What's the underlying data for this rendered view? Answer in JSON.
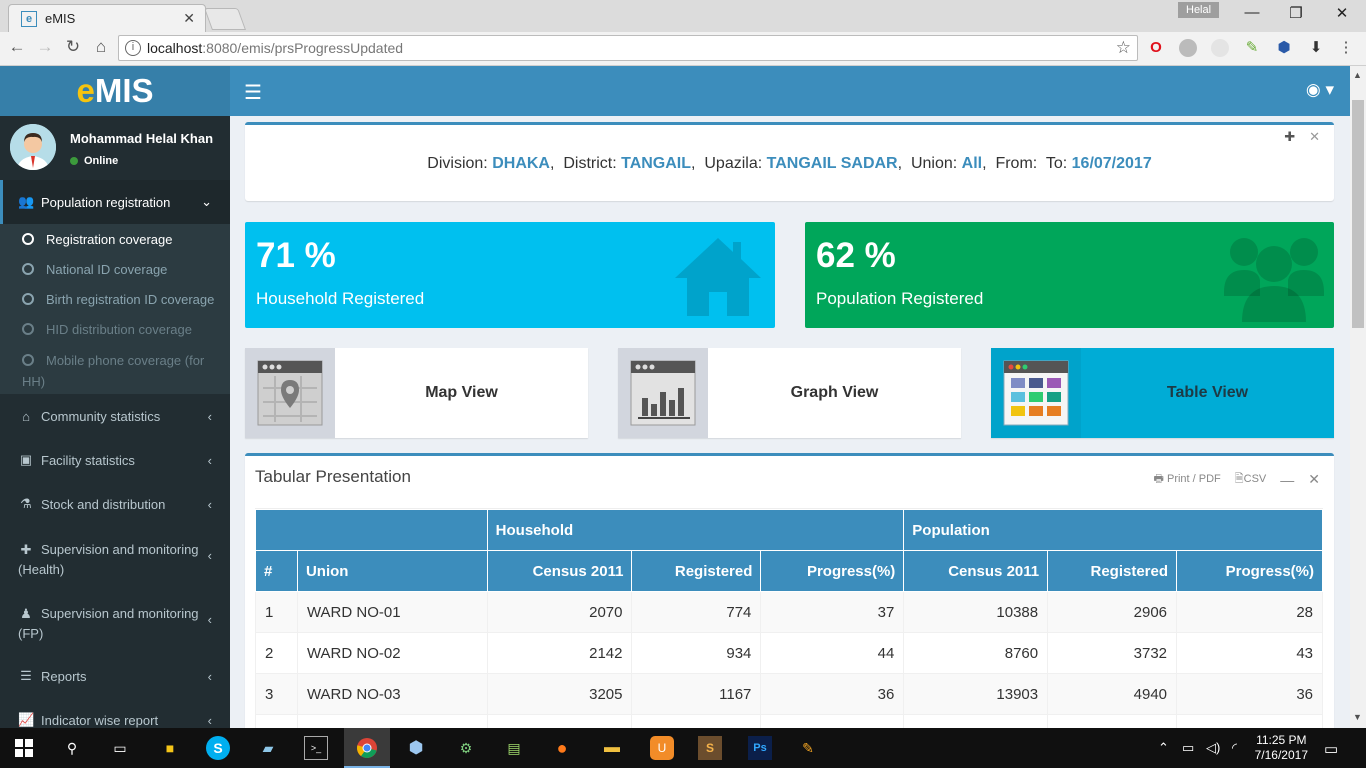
{
  "browser": {
    "tab_title": "eMIS",
    "tab_favicon": "e",
    "profile_name": "Helal",
    "url_host": "localhost",
    "url_rest": ":8080/emis/prsProgressUpdated"
  },
  "app": {
    "logo_e": "e",
    "logo_rest": "MIS",
    "user_name": "Mohammad Helal Khan",
    "user_status": "Online"
  },
  "sidebar": {
    "main_section": "Population registration",
    "sub_items": [
      "Registration coverage",
      "National ID coverage",
      "Birth registration ID coverage",
      "HID distribution coverage",
      "Mobile phone coverage (for",
      "HH)"
    ],
    "items": [
      "Community statistics",
      "Facility statistics",
      "Stock and distribution",
      "Supervision and monitoring",
      "(Health)",
      "Supervision and monitoring",
      "(FP)",
      "Reports",
      "Indicator wise report"
    ]
  },
  "filter": {
    "division_label": "Division:",
    "division": "DHAKA",
    "district_label": "District:",
    "district": "TANGAIL",
    "upazila_label": "Upazila:",
    "upazila": "TANGAIL SADAR",
    "union_label": "Union:",
    "union": "All",
    "from_label": "From:",
    "to_label": "To:",
    "to": "16/07/2017"
  },
  "stats": {
    "household_value": "71 %",
    "household_label": "Household Registered",
    "population_value": "62 %",
    "population_label": "Population Registered",
    "colors": {
      "household": "#00c0ef",
      "population": "#00a65a"
    }
  },
  "views": {
    "map": "Map View",
    "graph": "Graph View",
    "table": "Table View"
  },
  "table": {
    "title": "Tabular Presentation",
    "print": "Print / PDF",
    "csv": "CSV",
    "group_household": "Household",
    "group_population": "Population",
    "columns": [
      "#",
      "Union",
      "Census 2011",
      "Registered",
      "Progress(%)",
      "Census 2011",
      "Registered",
      "Progress(%)"
    ],
    "rows": [
      [
        "1",
        "WARD NO-01",
        "2070",
        "774",
        "37",
        "10388",
        "2906",
        "28"
      ],
      [
        "2",
        "WARD NO-02",
        "2142",
        "934",
        "44",
        "8760",
        "3732",
        "43"
      ],
      [
        "3",
        "WARD NO-03",
        "3205",
        "1167",
        "36",
        "13903",
        "4940",
        "36"
      ]
    ]
  },
  "taskbar": {
    "time": "11:25 PM",
    "date": "7/16/2017"
  }
}
